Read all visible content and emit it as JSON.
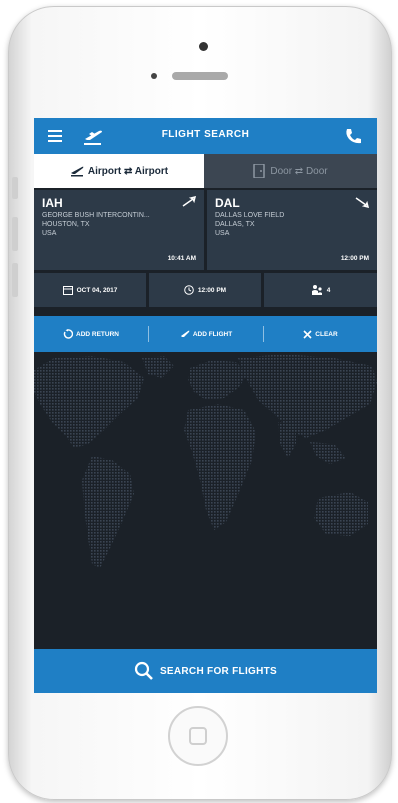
{
  "header": {
    "title": "FLIGHT SEARCH"
  },
  "tabs": [
    {
      "label": "Airport ⇄ Airport",
      "active": true
    },
    {
      "label": "Door ⇄ Door",
      "active": false
    }
  ],
  "origin": {
    "code": "IAH",
    "name": "GEORGE BUSH INTERCONTIN...",
    "city": "HOUSTON, TX",
    "country": "USA",
    "time": "10:41 AM"
  },
  "destination": {
    "code": "DAL",
    "name": "DALLAS LOVE FIELD",
    "city": "DALLAS, TX",
    "country": "USA",
    "time": "12:00 PM"
  },
  "options": {
    "date": "OCT 04, 2017",
    "time": "12:00 PM",
    "passengers": "4"
  },
  "actions": {
    "add_return": "ADD RETURN",
    "add_flight": "ADD FLIGHT",
    "clear": "CLEAR"
  },
  "search": {
    "label": "SEARCH FOR FLIGHTS"
  },
  "colors": {
    "accent": "#1f7fc5",
    "panel": "#2d3a48",
    "background": "#1b2128"
  },
  "icons": [
    "menu-icon",
    "plane-departure-icon",
    "phone-icon",
    "plane-icon",
    "door-icon",
    "calendar-icon",
    "clock-icon",
    "passengers-icon",
    "return-icon",
    "add-flight-icon",
    "clear-icon",
    "search-icon"
  ]
}
